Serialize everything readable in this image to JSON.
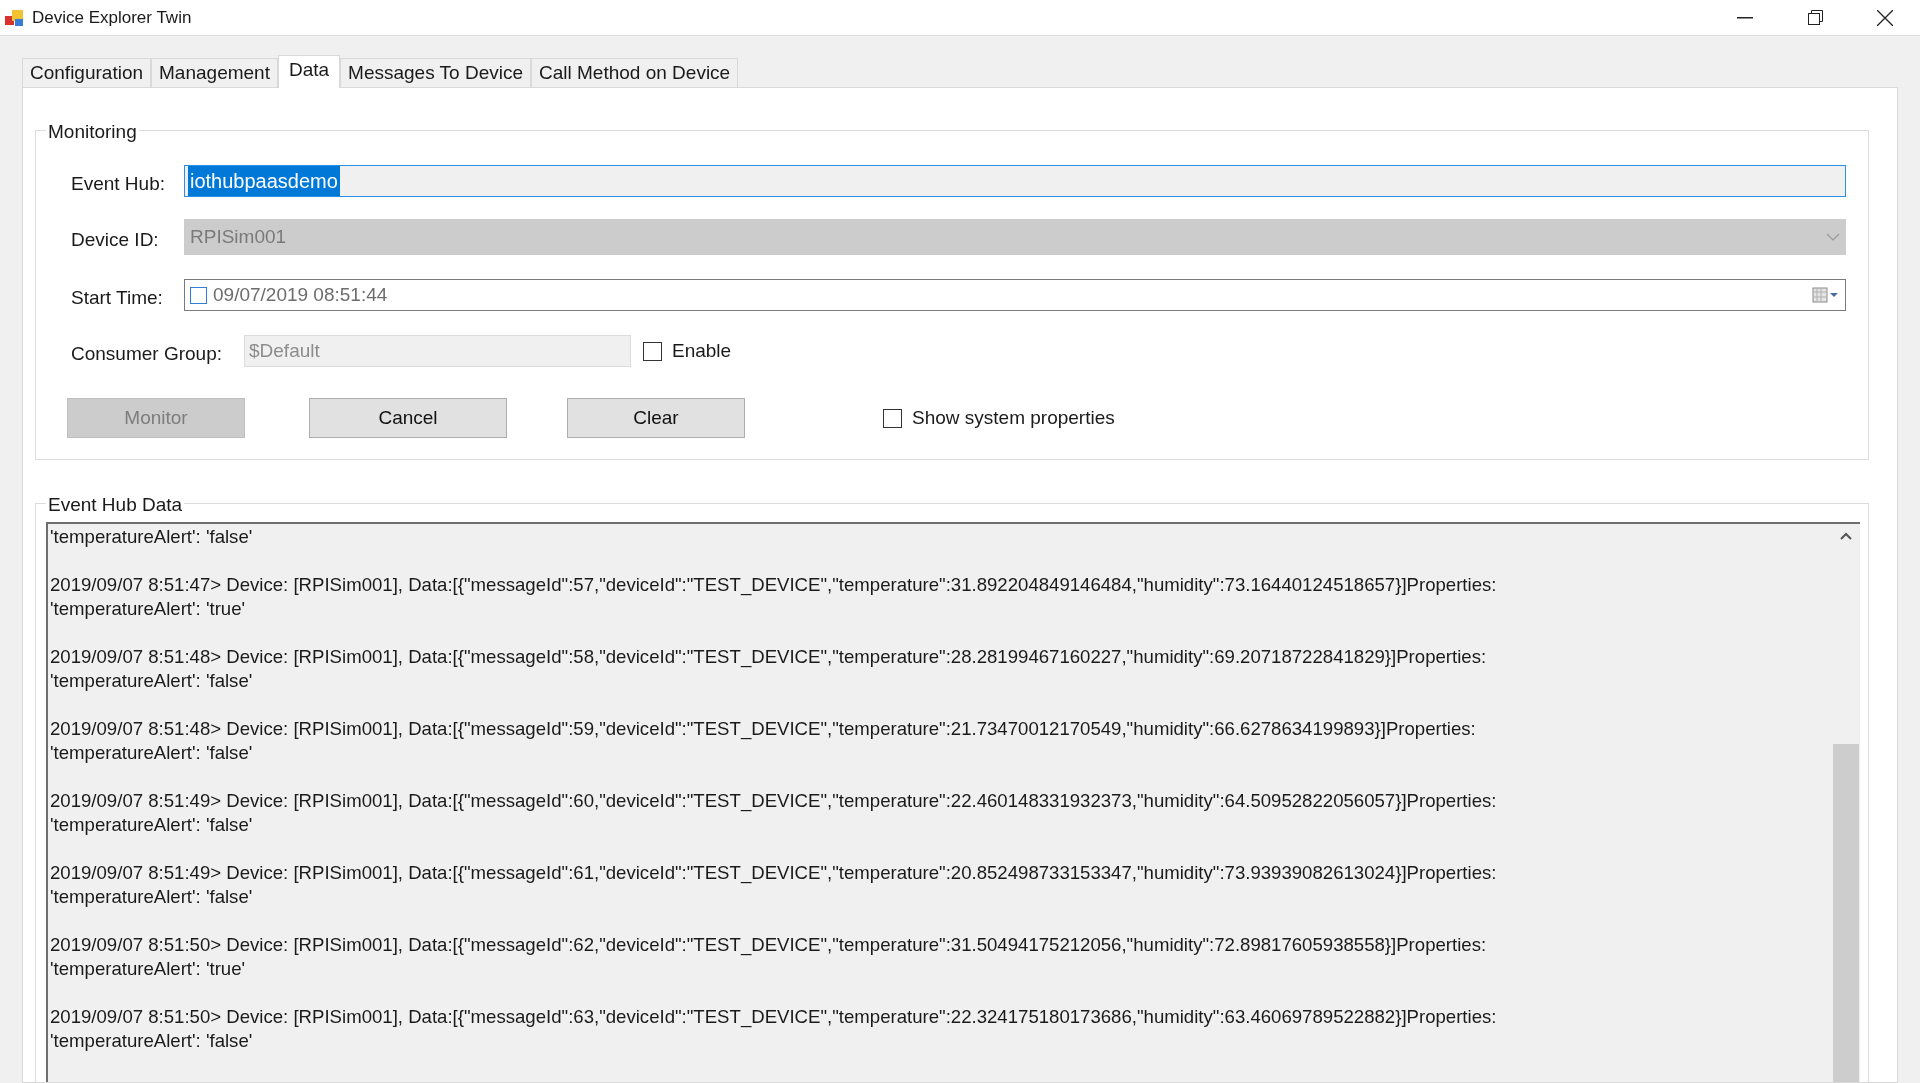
{
  "window": {
    "title": "Device Explorer Twin"
  },
  "tabs": [
    {
      "label": "Configuration",
      "selected": false
    },
    {
      "label": "Management",
      "selected": false
    },
    {
      "label": "Data",
      "selected": true
    },
    {
      "label": "Messages To Device",
      "selected": false
    },
    {
      "label": "Call Method on Device",
      "selected": false
    }
  ],
  "monitoring": {
    "title": "Monitoring",
    "event_hub": {
      "label": "Event Hub:",
      "value": "iothubpaasdemo",
      "text_selected": true
    },
    "device_id": {
      "label": "Device ID:",
      "value": "RPISim001",
      "disabled": true
    },
    "start_time": {
      "label": "Start Time:",
      "value": "09/07/2019 08:51:44",
      "checked": false
    },
    "consumer_group": {
      "label": "Consumer Group:",
      "value": "$Default",
      "disabled": true,
      "enable_label": "Enable",
      "enable_checked": false
    },
    "buttons": [
      {
        "label": "Monitor",
        "disabled": true
      },
      {
        "label": "Cancel",
        "disabled": false
      },
      {
        "label": "Clear",
        "disabled": false
      }
    ],
    "show_system_properties": {
      "label": "Show system properties",
      "checked": false
    }
  },
  "event_hub_data": {
    "title": "Event Hub Data",
    "entries": [
      {
        "lines": [
          "'temperatureAlert': 'false'"
        ]
      },
      {
        "lines": [
          "2019/09/07 8:51:47> Device: [RPISim001], Data:[{\"messageId\":57,\"deviceId\":\"TEST_DEVICE\",\"temperature\":31.892204849146484,\"humidity\":73.16440124518657}]Properties:",
          "'temperatureAlert': 'true'"
        ]
      },
      {
        "lines": [
          "2019/09/07 8:51:48> Device: [RPISim001], Data:[{\"messageId\":58,\"deviceId\":\"TEST_DEVICE\",\"temperature\":28.28199467160227,\"humidity\":69.20718722841829}]Properties:",
          "'temperatureAlert': 'false'"
        ]
      },
      {
        "lines": [
          "2019/09/07 8:51:48> Device: [RPISim001], Data:[{\"messageId\":59,\"deviceId\":\"TEST_DEVICE\",\"temperature\":21.73470012170549,\"humidity\":66.6278634199893}]Properties:",
          "'temperatureAlert': 'false'"
        ]
      },
      {
        "lines": [
          "2019/09/07 8:51:49> Device: [RPISim001], Data:[{\"messageId\":60,\"deviceId\":\"TEST_DEVICE\",\"temperature\":22.460148331932373,\"humidity\":64.50952822056057}]Properties:",
          "'temperatureAlert': 'false'"
        ]
      },
      {
        "lines": [
          "2019/09/07 8:51:49> Device: [RPISim001], Data:[{\"messageId\":61,\"deviceId\":\"TEST_DEVICE\",\"temperature\":20.852498733153347,\"humidity\":73.93939082613024}]Properties:",
          "'temperatureAlert': 'false'"
        ]
      },
      {
        "lines": [
          "2019/09/07 8:51:50> Device: [RPISim001], Data:[{\"messageId\":62,\"deviceId\":\"TEST_DEVICE\",\"temperature\":31.50494175212056,\"humidity\":72.89817605938558}]Properties:",
          "'temperatureAlert': 'true'"
        ]
      },
      {
        "lines": [
          "2019/09/07 8:51:50> Device: [RPISim001], Data:[{\"messageId\":63,\"deviceId\":\"TEST_DEVICE\",\"temperature\":22.324175180173686,\"humidity\":63.46069789522882}]Properties:",
          "'temperatureAlert': 'false'"
        ]
      }
    ]
  }
}
